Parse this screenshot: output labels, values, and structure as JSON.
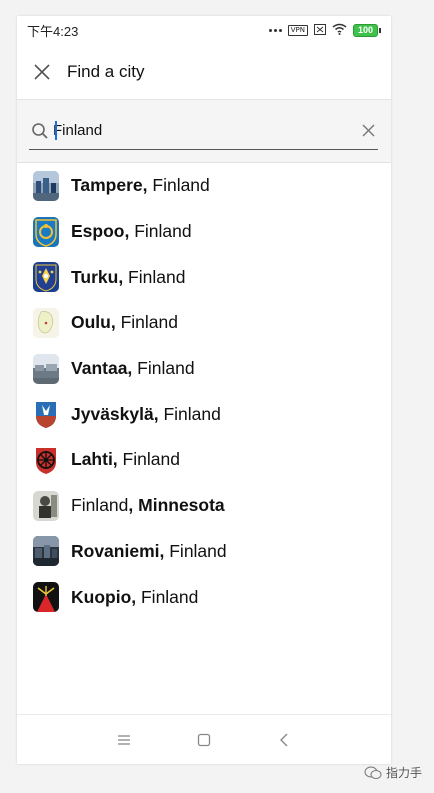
{
  "status_bar": {
    "time": "下午4:23",
    "vpn_label": "VPN",
    "battery": "100"
  },
  "header": {
    "close_icon": "close-icon",
    "title": "Find a city"
  },
  "search": {
    "value": "Finland",
    "search_icon": "search-icon",
    "clear_icon": "clear-icon"
  },
  "cities": [
    {
      "bold": "Tampere,",
      "rest": " Finland",
      "icon": "tampere-thumbnail"
    },
    {
      "bold": "Espoo,",
      "rest": " Finland",
      "icon": "espoo-coat-of-arms"
    },
    {
      "bold": "Turku,",
      "rest": " Finland",
      "icon": "turku-coat-of-arms"
    },
    {
      "bold": "Oulu,",
      "rest": " Finland",
      "icon": "oulu-map-thumbnail"
    },
    {
      "bold": "Vantaa,",
      "rest": " Finland",
      "icon": "vantaa-thumbnail"
    },
    {
      "bold": "Jyväskylä,",
      "rest": " Finland",
      "icon": "jyvaskyla-coat-of-arms"
    },
    {
      "bold": "Lahti,",
      "rest": " Finland",
      "icon": "lahti-coat-of-arms"
    },
    {
      "pre": "Finland",
      "bold": ", Minnesota",
      "icon": "minnesota-thumbnail"
    },
    {
      "bold": "Rovaniemi,",
      "rest": " Finland",
      "icon": "rovaniemi-thumbnail"
    },
    {
      "bold": "Kuopio,",
      "rest": " Finland",
      "icon": "kuopio-coat-of-arms"
    }
  ],
  "nav": {
    "menu_icon": "menu-icon",
    "home_icon": "home-icon",
    "back_icon": "back-icon"
  },
  "watermark": {
    "text": "指力手"
  }
}
